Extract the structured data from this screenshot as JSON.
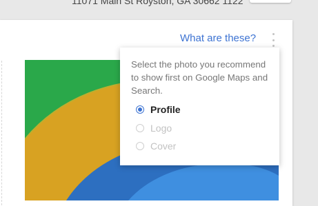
{
  "header": {
    "address": "11071 Main St Royston, GA 30662 1122"
  },
  "card": {
    "help_link": "What are these?",
    "more_icon": "more-vert-icon"
  },
  "popup": {
    "description": "Select the photo you recommend to show first on Google Maps and Search.",
    "options": [
      {
        "label": "Profile",
        "selected": true
      },
      {
        "label": "Logo",
        "selected": false
      },
      {
        "label": "Cover",
        "selected": false
      }
    ]
  },
  "colors": {
    "link": "#3d73d2",
    "radio_selected": "#3d73d2",
    "disabled_text": "#c2c2c2",
    "photo_green": "#2aa84a",
    "photo_yellow": "#d8a222",
    "photo_blue": "#2d6fc0"
  }
}
